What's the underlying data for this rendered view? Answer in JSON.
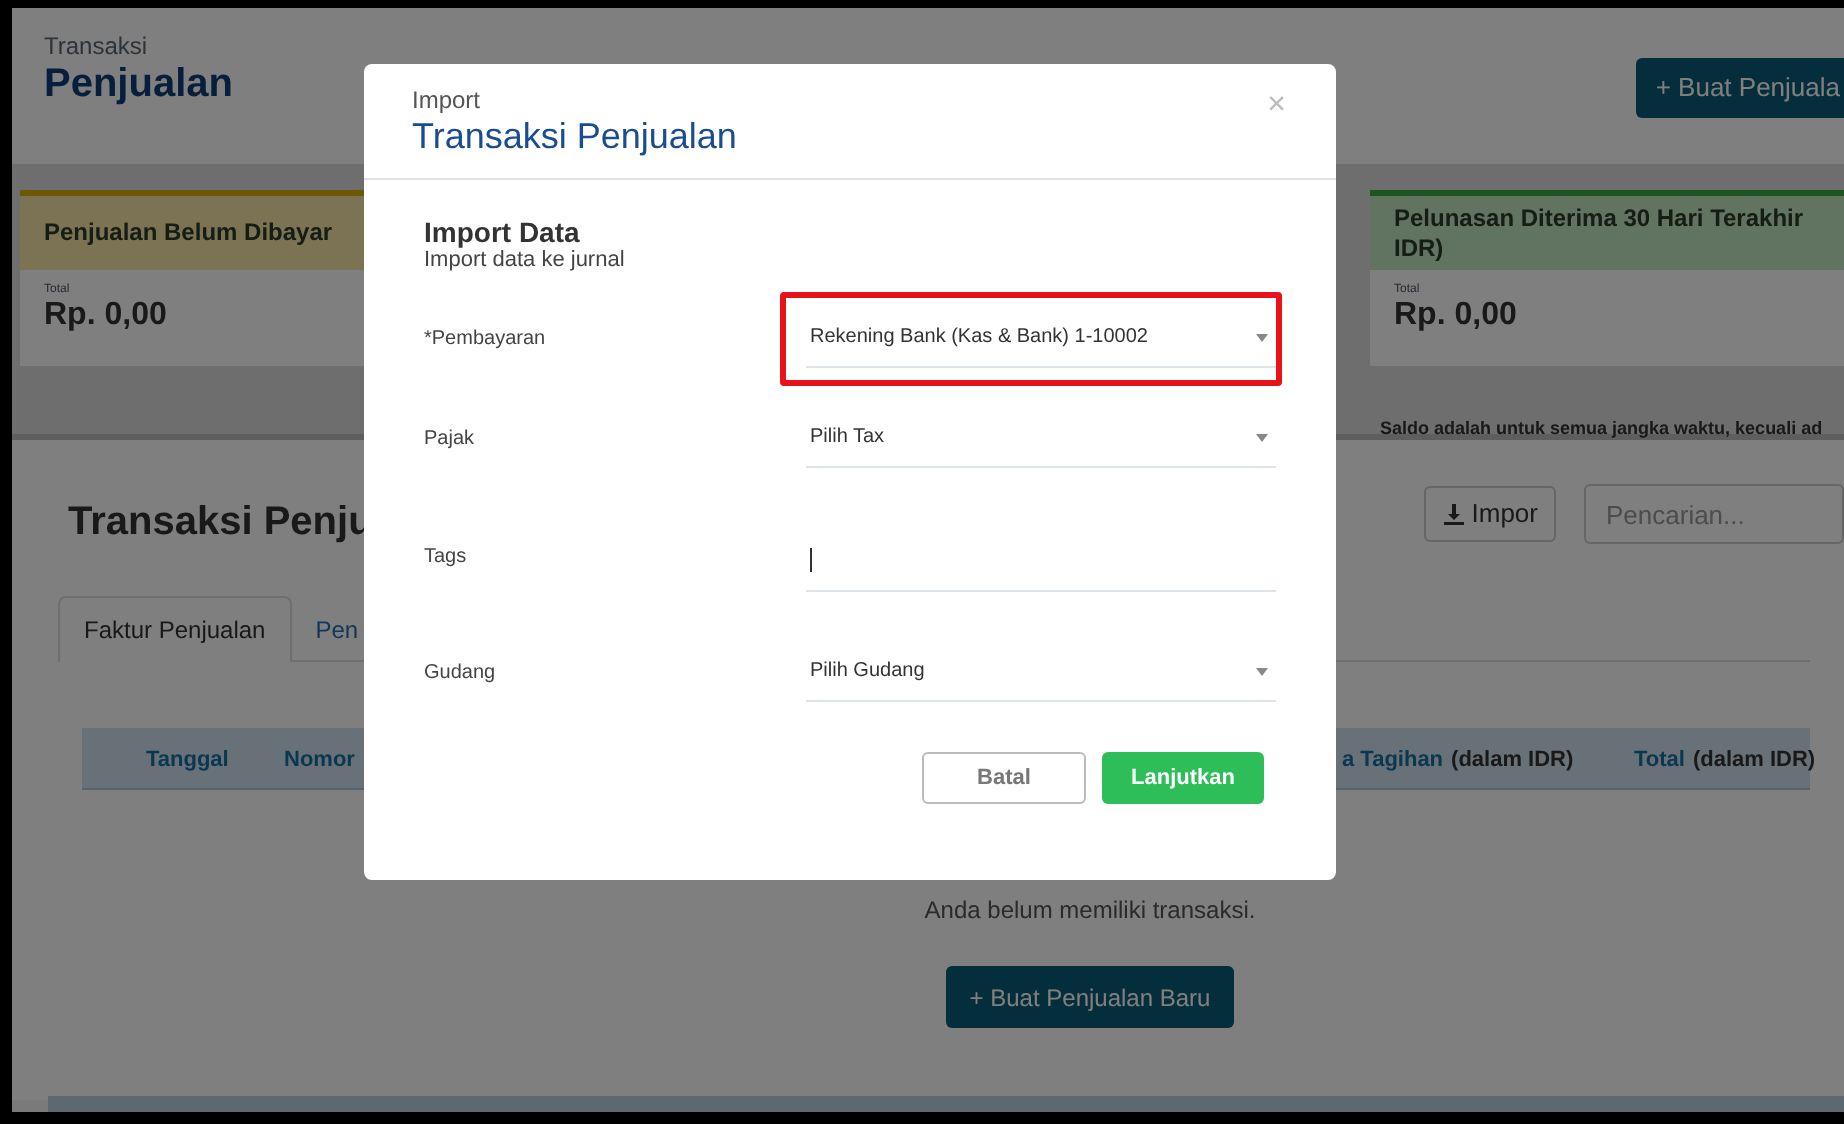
{
  "page": {
    "kicker": "Transaksi",
    "title": "Penjualan",
    "create_button": "+ Buat Penjuala"
  },
  "cards": [
    {
      "kind": "unpaid",
      "title_lines": [
        "Penjualan Belum Dibayar"
      ],
      "total_label": "Total",
      "total": "Rp. 0,00"
    },
    {
      "kind": "paid",
      "title_lines": [
        "Pelunasan Diterima 30 Hari Terakhir",
        "IDR)"
      ],
      "total_label": "Total",
      "total": "Rp. 0,00"
    }
  ],
  "balance_note": "Saldo adalah untuk semua jangka waktu, kecuali ad",
  "section": {
    "title": "Transaksi Penju",
    "import_button": "Impor",
    "search": {
      "placeholder": "Pencarian..."
    }
  },
  "tabs": [
    {
      "label": "Faktur Penjualan",
      "selected": true
    },
    {
      "label": "Pen",
      "selected": false
    }
  ],
  "table": {
    "columns": [
      {
        "label": "Tanggal"
      },
      {
        "label": "Nomor"
      },
      {
        "label": "a Tagihan",
        "unit": "(dalam IDR)"
      },
      {
        "label": "Total",
        "unit": "(dalam IDR)"
      }
    ],
    "empty_text": "Anda belum memiliki transaksi.",
    "new_button": "+ Buat Penjualan Baru"
  },
  "modal": {
    "kicker": "Import",
    "title": "Transaksi Penjualan",
    "close": "×",
    "heading": "Import Data",
    "subheading": "Import data ke jurnal",
    "fields": [
      {
        "kind": "select",
        "label": "*Pembayaran",
        "value": "Rekening Bank (Kas & Bank) 1-10002",
        "highlighted": true
      },
      {
        "kind": "select",
        "label": "Pajak",
        "placeholder": "Pilih Tax",
        "highlighted": false
      },
      {
        "kind": "text",
        "label": "Tags",
        "focused": true,
        "highlighted": false
      },
      {
        "kind": "select",
        "label": "Gudang",
        "placeholder": "Pilih Gudang",
        "highlighted": false
      }
    ],
    "buttons": [
      {
        "kind": "secondary",
        "label": "Batal"
      },
      {
        "kind": "primary",
        "label": "Lanjutkan"
      }
    ]
  }
}
